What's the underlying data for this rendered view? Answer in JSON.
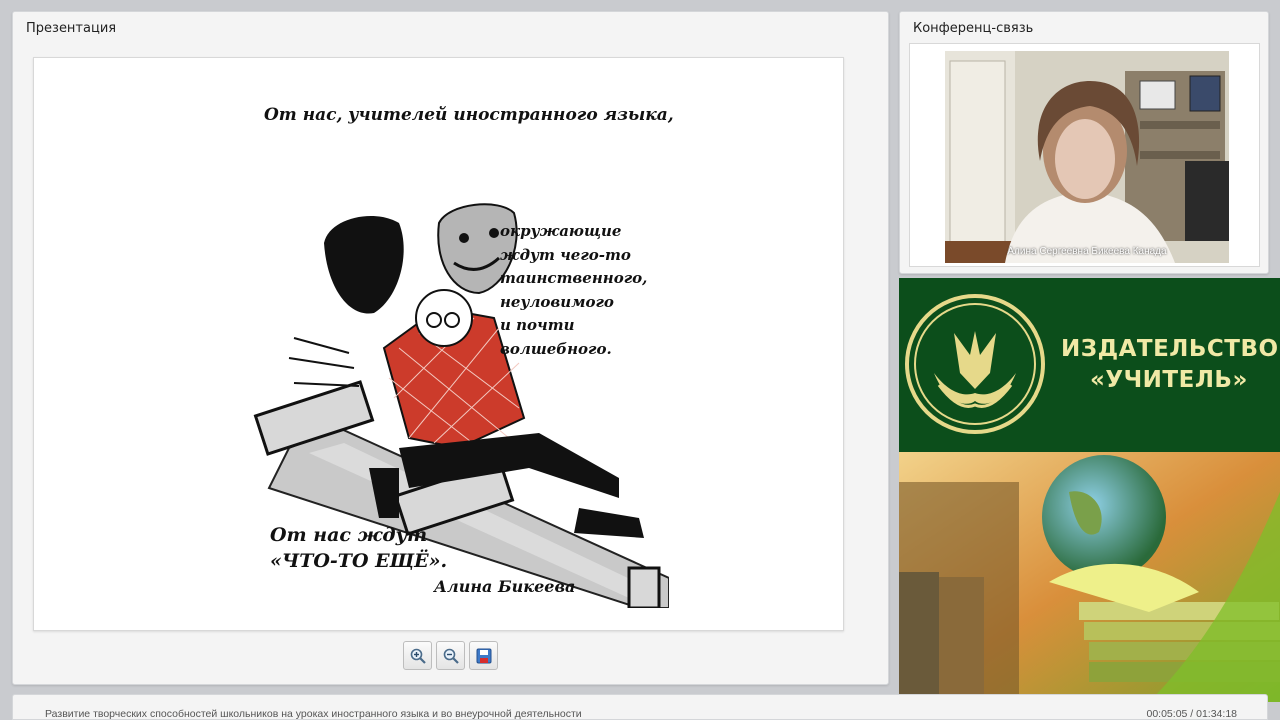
{
  "presentation": {
    "title": "Презентация",
    "slide": {
      "heading": "От нас, учителей иностранного языка,",
      "side_lines": [
        "окружающие",
        "ждут чего-то",
        "таинственного,",
        "неуловимого",
        "и почти",
        "волшебного."
      ],
      "quote_line1": "От нас ждут",
      "quote_line2": "«ЧТО-ТО ЕЩЁ».",
      "author": "Алина Бикеева"
    },
    "toolbar": {
      "zoom_in_icon": "zoom-in-icon",
      "zoom_out_icon": "zoom-out-icon",
      "save_icon": "save-icon"
    }
  },
  "conference": {
    "title": "Конференц-связь",
    "participant_caption": "Алина Сергеевна Бикеева Канада"
  },
  "publisher": {
    "name_line1": "ИЗДАТЕЛЬСТВО",
    "name_line2": "«УЧИТЕЛЬ»"
  },
  "status": {
    "webinar_title": "Развитие творческих способностей школьников на уроках иностранного языка и во внеурочной деятельности",
    "time": "00:05:05 / 01:34:18"
  },
  "colors": {
    "publisher_green": "#0c4e1b",
    "publisher_text": "#f0e9a6",
    "panel_bg": "#f4f4f4",
    "page_bg": "#c9cbcf"
  }
}
